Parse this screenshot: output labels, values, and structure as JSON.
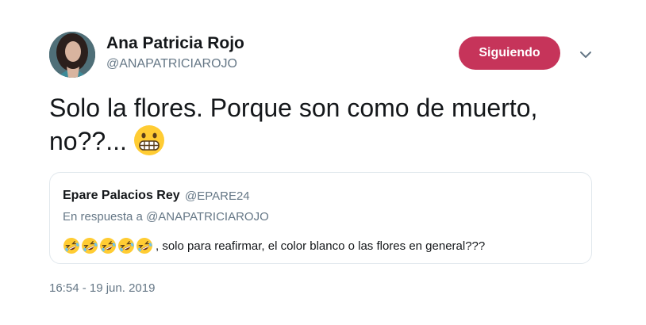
{
  "tweet": {
    "author": {
      "name": "Ana Patricia Rojo",
      "handle": "@ANAPATRICIAROJO"
    },
    "follow_button_label": "Siguiendo",
    "text": "Solo la flores. Porque son como de muerto, no??...",
    "text_emoji": "grimacing-face",
    "timestamp": "16:54 - 19 jun. 2019"
  },
  "quoted_tweet": {
    "author_name": "Epare Palacios Rey",
    "author_handle": "@EPARE24",
    "reply_prefix": "En respuesta a",
    "reply_mention": "@ANAPATRICIAROJO",
    "emoji": "rolling-on-floor-laughing",
    "emoji_count": 5,
    "text": ", solo para reafirmar, el color blanco o las flores en general???"
  },
  "colors": {
    "follow_button": "#c6345a",
    "secondary_text": "#657786",
    "primary_text": "#14171a",
    "border": "#e1e8ed"
  }
}
